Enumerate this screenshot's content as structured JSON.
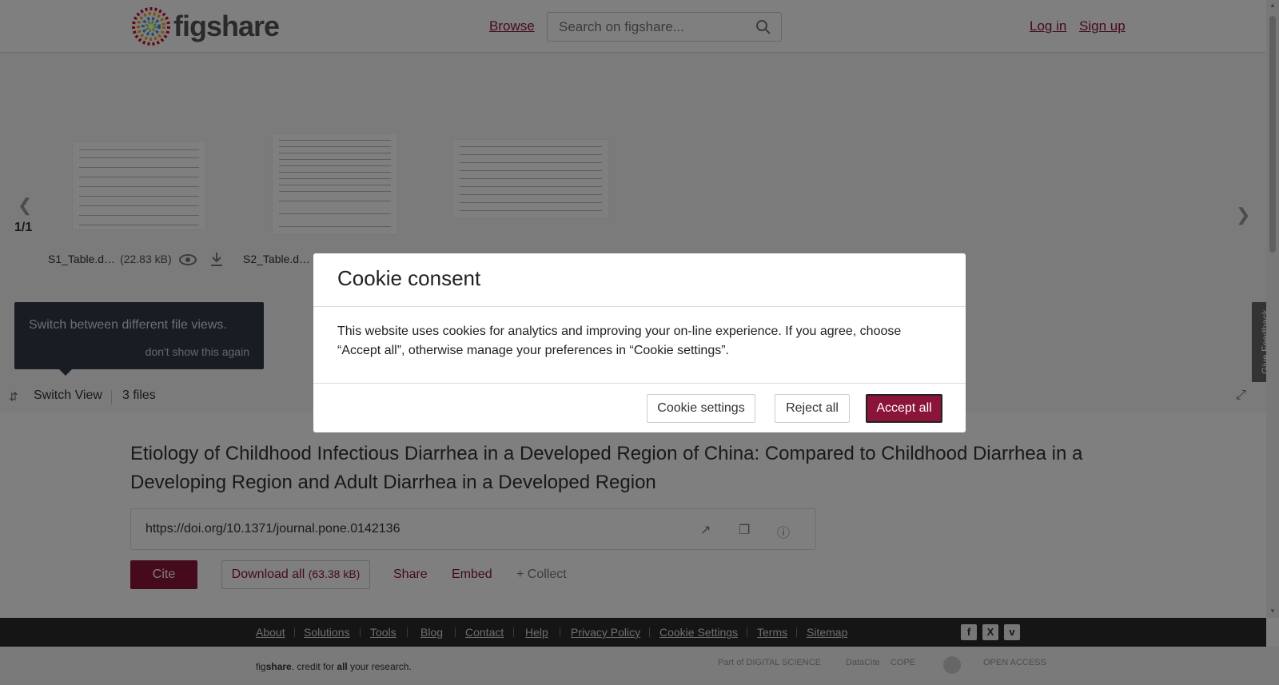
{
  "header": {
    "logo_text": "figshare",
    "browse_label": "Browse",
    "search_placeholder": "Search on figshare...",
    "login_label": "Log in",
    "signup_label": "Sign up"
  },
  "viewer": {
    "page_count": "1/1",
    "files": [
      {
        "name": "S1_Table.d…",
        "size": "(22.83 kB)"
      },
      {
        "name": "S2_Table.d…",
        "size": ""
      },
      {
        "name": "",
        "size": ""
      }
    ],
    "tooltip_text": "Switch between different file views.",
    "tooltip_dismiss": "don't show this again",
    "switch_view_label": "Switch View",
    "file_count": "3 files",
    "feedback_label": "Give Feedback"
  },
  "article": {
    "title": "Etiology of Childhood Infectious Diarrhea in a Developed Region of China: Compared to Childhood Diarrhea in a Developing Region and Adult Diarrhea in a Developed Region",
    "doi": "https://doi.org/10.1371/journal.pone.0142136",
    "cite_label": "Cite",
    "download_label": "Download all",
    "download_size": "(63.38 kB)",
    "share_label": "Share",
    "embed_label": "Embed",
    "collect_label": "+ Collect"
  },
  "footer": {
    "links": [
      "About",
      "Solutions",
      "Tools",
      "Blog",
      "Contact",
      "Help",
      "Privacy Policy",
      "Cookie Settings",
      "Terms",
      "Sitemap"
    ],
    "tagline_fig": "fig",
    "tagline_share": "share",
    "tagline_mid": ". credit for ",
    "tagline_all": "all",
    "tagline_end": " your research.",
    "partners": [
      "Part of DIGITAL SCIENCE",
      "DataCite",
      "COPE",
      "",
      "OPEN ACCESS"
    ]
  },
  "cookie_modal": {
    "title": "Cookie consent",
    "body": "This website uses cookies for analytics and improving your on-line experience. If you agree, choose “Accept all”, otherwise manage your preferences in “Cookie settings”.",
    "settings_label": "Cookie settings",
    "reject_label": "Reject all",
    "accept_label": "Accept all"
  },
  "colors": {
    "accent": "#8a1538",
    "footer_bg": "#2b2b2b"
  }
}
